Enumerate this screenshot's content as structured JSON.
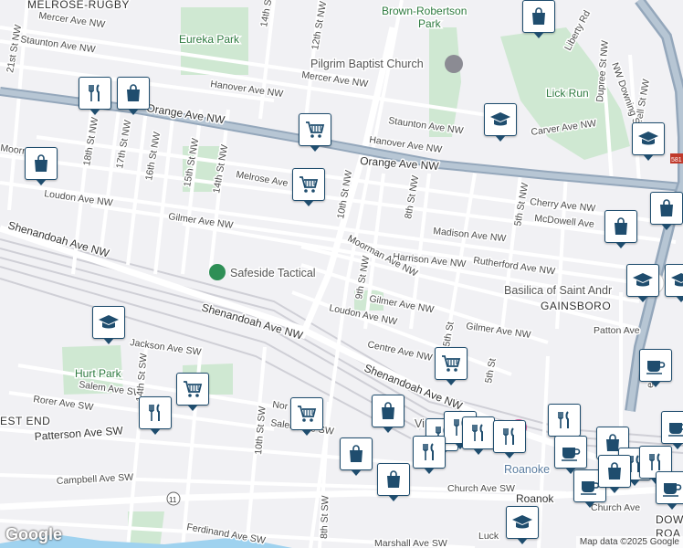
{
  "neighborhoods": [
    "MELROSE-RUGBY",
    "GAINSBORO",
    "EST END",
    "DOW",
    "ROA"
  ],
  "parks": [
    "Eureka Park",
    "Brown-Robertson",
    "Park",
    "Lick Run",
    "Hurt Park"
  ],
  "places": [
    "Pilgrim Baptist Church",
    "Safeside Tactical",
    "Basilica of Saint Andr",
    "Vi",
    "um",
    "on",
    "Roanoke",
    "Roanok"
  ],
  "streets": {
    "mercer_w": "Mercer Ave NW",
    "staunton_w": "Staunton Ave NW",
    "mercer_e": "Mercer Ave NW",
    "hanover_w": "Hanover Ave NW",
    "staunton_e": "Staunton Ave NW",
    "hanover_e": "Hanover Ave NW",
    "carver": "Carver Ave NW",
    "orange_w": "Orange Ave NW",
    "orange_e": "Orange Ave NW",
    "melrose": "Melrose Ave",
    "moorman_w": "Moorman",
    "loudon_w": "Loudon Ave NW",
    "gilmer_w": "Gilmer Ave NW",
    "cherry": "Cherry Ave NW",
    "mcdowell": "McDowell Ave",
    "madison": "Madison Ave NW",
    "harrison": "Harrison Ave NW",
    "rutherford": "Rutherford Ave NW",
    "moorman_e": "Moorman Ave NW",
    "gilmer_e": "Gilmer Ave NW",
    "gilmer_e2": "Gilmer Ave NW",
    "loudon_e": "Loudon Ave NW",
    "patton": "Patton Ave",
    "centre": "Centre Ave NW",
    "shen_w": "Shenandoah Ave NW",
    "shen_m": "Shenandoah Ave NW",
    "shen_e": "Shenandoah Ave NW",
    "jackson": "Jackson Ave SW",
    "salem_w": "Salem Ave SW",
    "rorer": "Rorer Ave SW",
    "norfolk": "Nor",
    "salem_e": "Salem Ave SW",
    "patterson": "Patterson Ave SW",
    "campbell": "Campbell Ave SW",
    "ferdinand": "Ferdinand Ave SW",
    "marshall": "Marshall Ave SW",
    "church": "Church Ave SW",
    "church2": "Church Ave",
    "luck": "Luck",
    "s21": "21st St NW",
    "s18": "18th St NW",
    "s17": "17th St NW",
    "s16": "16th St NW",
    "s15": "15th St NW",
    "s14": "14th St NW",
    "s14b": "14th St",
    "s12": "12th St NW",
    "s10": "10th St NW",
    "s9": "9th St NW",
    "s8": "8th St NW",
    "s5": "5th St NW",
    "s10sw": "10th St SW",
    "s14sw": "14th St SW",
    "s8sw": "8th St SW",
    "s5b": "5th St",
    "s5c": "5th St",
    "liberty": "Liberty Rd",
    "dupree": "Dupree St NW",
    "burrell": "Burrell St NW",
    "downing": "NW Downing S",
    "jeff": "erson St",
    "route11": "11",
    "route581": "581"
  },
  "footer": {
    "logo": "Google",
    "attribution": "Map data ©2025 Google"
  },
  "icons": {
    "restaurant": "fork-knife-icon",
    "shopping": "shopping-bag-icon",
    "grocery": "shopping-cart-icon",
    "school": "graduation-cap-icon",
    "cafe": "coffee-cup-icon"
  },
  "colors": {
    "pin_bg": "#ffffff",
    "pin_border": "#1f4d6e",
    "icon": "#1f4d6e",
    "park": "#c8e6c9",
    "road": "#ffffff",
    "highway": "#8fa3b8",
    "rail": "#c9c9cf"
  }
}
